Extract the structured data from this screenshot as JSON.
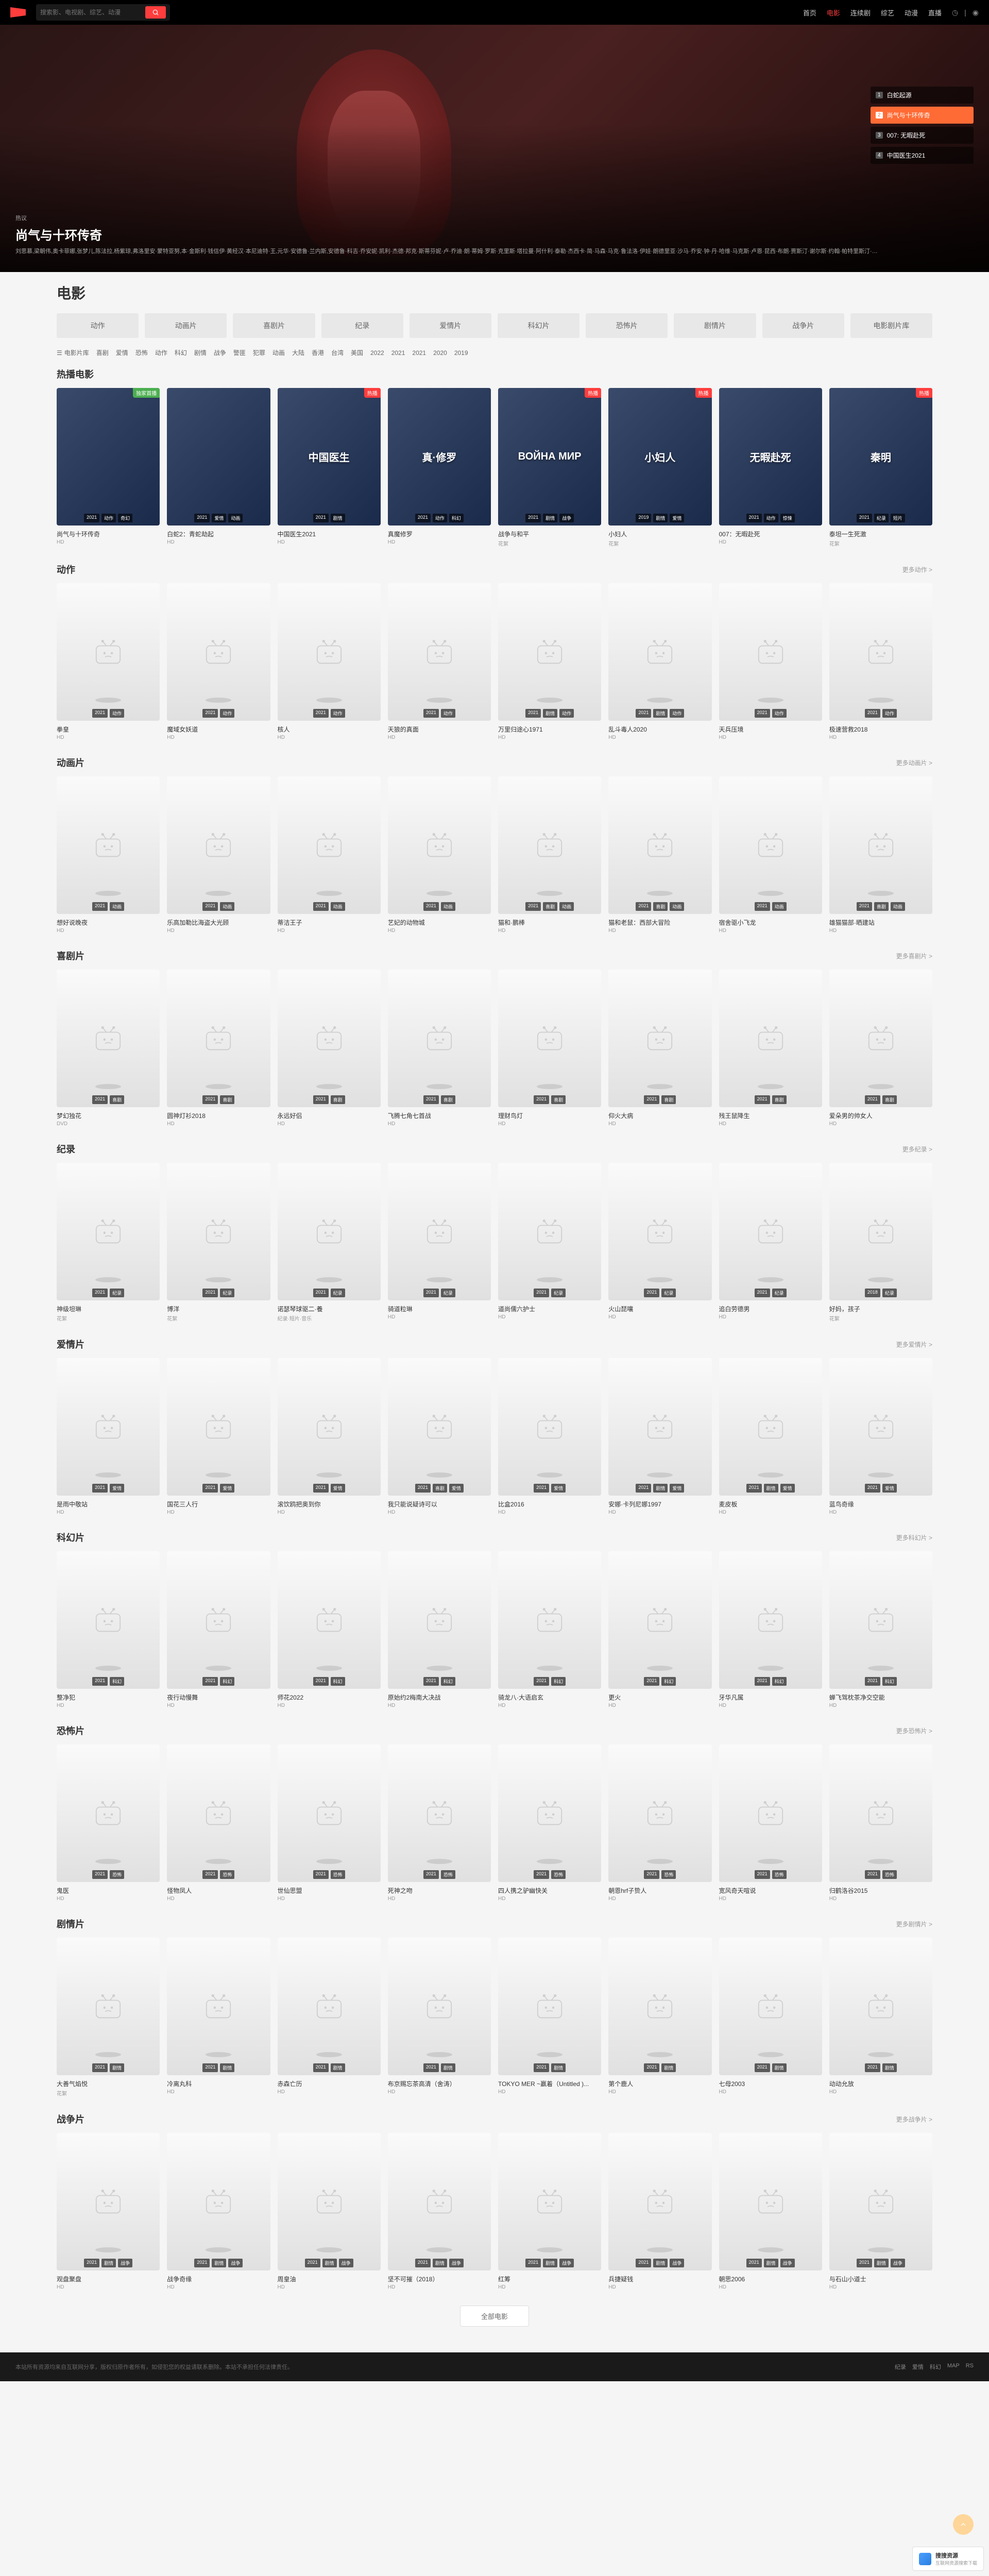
{
  "header": {
    "search_placeholder": "搜索影、电视剧、综艺、动漫",
    "nav": [
      "首页",
      "电影",
      "连续剧",
      "综艺",
      "动漫",
      "直播"
    ],
    "nav_active": 1
  },
  "hero": {
    "badge": "热议",
    "title": "尚气与十环传奇",
    "desc": "刘思慕,梁朝伟,奥卡菲娜,张梦儿,陈法拉,杨紫琼,弗洛里安·蒙特亚努,本·金斯利·钱信伊·黄经汉·本尼迪特·王,元华·安德鲁·兰内斯,安德鲁·科吉·乔安妮·凯利·杰德·邦克·斯蒂芬妮·卢·乔迪·朗·蒂姆·罗斯·克里斯·塔拉曼·阿什利·泰勒·杰西卡·简·马森·马克·鲁法洛·伊娃·朗德里亚·沙马·乔安·钟·丹·哈维·马克斯·卢恩·昆西·布朗·贾斯汀·谢尔斯·约翰·帕特里斯汀·张·格雷格·塔诺斯卡·明·戴尔·安布鲁斯·阿库吉·扎·哈诺德·张",
    "sidebar": [
      {
        "n": "1",
        "label": "白蛇起源"
      },
      {
        "n": "2",
        "label": "尚气与十环传奇"
      },
      {
        "n": "3",
        "label": "007: 无暇赴死"
      },
      {
        "n": "4",
        "label": "中国医生2021"
      }
    ],
    "sidebar_active": 1
  },
  "page_title": "电影",
  "cat_tabs": [
    "动作",
    "动画片",
    "喜剧片",
    "纪录",
    "爱情片",
    "科幻片",
    "恐怖片",
    "剧情片",
    "战争片",
    "电影剧片库"
  ],
  "filters": {
    "label": "电影片库",
    "items": [
      "喜剧",
      "爱情",
      "恐怖",
      "动作",
      "科幻",
      "剧情",
      "战争",
      "警匪",
      "犯罪",
      "动画",
      "大陆",
      "香港",
      "台湾",
      "美国",
      "2022",
      "2021",
      "2021",
      "2020",
      "2019"
    ]
  },
  "chart_data": null,
  "sections": [
    {
      "title": "热播电影",
      "more": "",
      "real": true,
      "items": [
        {
          "title": "尚气与十环传奇",
          "sub": "HD",
          "badge": "独家首播",
          "bc": "green",
          "tags": [
            "2021",
            "动作",
            "奇幻"
          ],
          "cls": "p1"
        },
        {
          "title": "白蛇2：青蛇劫起",
          "sub": "HD",
          "badge": "",
          "tags": [
            "2021",
            "爱情",
            "动画"
          ],
          "cls": "p2"
        },
        {
          "title": "中国医生2021",
          "sub": "HD",
          "badge": "热播",
          "tags": [
            "2021",
            "剧情"
          ],
          "cls": "p3",
          "pt": "中国医生"
        },
        {
          "title": "真魔修罗",
          "sub": "HD",
          "badge": "",
          "tags": [
            "2021",
            "动作",
            "科幻"
          ],
          "cls": "p4",
          "pt": "真·修罗"
        },
        {
          "title": "战争与和平",
          "sub": "花絮",
          "badge": "热播",
          "tags": [
            "2021",
            "剧情",
            "战争"
          ],
          "cls": "p5",
          "pt": "ВОЙНА МИР"
        },
        {
          "title": "小妇人",
          "sub": "花絮",
          "badge": "热播",
          "tags": [
            "2019",
            "剧情",
            "爱情"
          ],
          "cls": "p6",
          "pt": "小妇人"
        },
        {
          "title": "007：无暇赴死",
          "sub": "HD",
          "badge": "",
          "tags": [
            "2021",
            "动作",
            "惊悚"
          ],
          "cls": "p7",
          "pt": "无暇赴死"
        },
        {
          "title": "泰坦一生死激",
          "sub": "花絮",
          "badge": "热播",
          "tags": [
            "2021",
            "纪录",
            "短片"
          ],
          "cls": "p8",
          "pt": "秦明"
        }
      ]
    },
    {
      "title": "动作",
      "more": "更多动作 >",
      "items": [
        {
          "title": "拳皇",
          "sub": "HD",
          "tags": [
            "2021",
            "动作"
          ]
        },
        {
          "title": "魔域女妖道",
          "sub": "HD",
          "tags": [
            "2021",
            "动作"
          ]
        },
        {
          "title": "核人",
          "sub": "HD",
          "tags": [
            "2021",
            "动作"
          ]
        },
        {
          "title": "天狼的真面",
          "sub": "HD",
          "tags": [
            "2021",
            "动作"
          ]
        },
        {
          "title": "万里归途心1971",
          "sub": "HD",
          "tags": [
            "2021",
            "剧情",
            "动作"
          ]
        },
        {
          "title": "乱斗毒人2020",
          "sub": "HD",
          "tags": [
            "2021",
            "剧情",
            "动作"
          ]
        },
        {
          "title": "天兵压境",
          "sub": "HD",
          "tags": [
            "2021",
            "动作"
          ]
        },
        {
          "title": "极速营救2018",
          "sub": "HD",
          "tags": [
            "2021",
            "动作"
          ]
        }
      ]
    },
    {
      "title": "动画片",
      "more": "更多动画片 >",
      "items": [
        {
          "title": "想好说晚夜",
          "sub": "HD",
          "tags": [
            "2021",
            "动画"
          ]
        },
        {
          "title": "乐高加勒比海盗大光顾",
          "sub": "HD",
          "tags": [
            "2021",
            "动画"
          ]
        },
        {
          "title": "蒂洁王子",
          "sub": "HD",
          "tags": [
            "2021",
            "动画"
          ]
        },
        {
          "title": "艺妃的动物城",
          "sub": "HD",
          "tags": [
            "2021",
            "动画"
          ]
        },
        {
          "title": "猫和·鹏棒",
          "sub": "HD",
          "tags": [
            "2021",
            "喜剧",
            "动画"
          ]
        },
        {
          "title": "猫和老鼠：西部大冒险",
          "sub": "HD",
          "tags": [
            "2021",
            "喜剧",
            "动画"
          ]
        },
        {
          "title": "宿舍驱小飞龙",
          "sub": "HD",
          "tags": [
            "2021",
            "动画"
          ]
        },
        {
          "title": "雄猫猫部·晒建站",
          "sub": "HD",
          "tags": [
            "2021",
            "喜剧",
            "动画"
          ]
        }
      ]
    },
    {
      "title": "喜剧片",
      "more": "更多喜剧片 >",
      "items": [
        {
          "title": "梦幻独花",
          "sub": "DVD",
          "tags": [
            "2021",
            "喜剧"
          ]
        },
        {
          "title": "圆神灯衫2018",
          "sub": "HD",
          "tags": [
            "2021",
            "喜剧"
          ]
        },
        {
          "title": "永远好侣",
          "sub": "HD",
          "tags": [
            "2021",
            "喜剧"
          ]
        },
        {
          "title": "飞腾七角七首战",
          "sub": "HD",
          "tags": [
            "2021",
            "喜剧"
          ]
        },
        {
          "title": "理财鸟灯",
          "sub": "HD",
          "tags": [
            "2021",
            "喜剧"
          ]
        },
        {
          "title": "仰火大病",
          "sub": "HD",
          "tags": [
            "2021",
            "喜剧"
          ]
        },
        {
          "title": "残王鼠降生",
          "sub": "HD",
          "tags": [
            "2021",
            "喜剧"
          ]
        },
        {
          "title": "爱朵男的帅女人",
          "sub": "HD",
          "tags": [
            "2021",
            "喜剧"
          ]
        }
      ]
    },
    {
      "title": "纪录",
      "more": "更多纪录 >",
      "items": [
        {
          "title": "神级坦琳",
          "sub": "花絮",
          "tags": [
            "2021",
            "纪录"
          ]
        },
        {
          "title": "博洋",
          "sub": "花絮",
          "tags": [
            "2021",
            "纪录"
          ]
        },
        {
          "title": "诺瑟琴球驱二·養",
          "sub": "纪录·短片·音乐",
          "tags": [
            "2021",
            "纪录"
          ]
        },
        {
          "title": "骑道粒琳",
          "sub": "HD",
          "tags": [
            "2021",
            "纪录"
          ]
        },
        {
          "title": "道尚儒六护士",
          "sub": "HD",
          "tags": [
            "2021",
            "纪录"
          ]
        },
        {
          "title": "火山琵嚷",
          "sub": "HD",
          "tags": [
            "2021",
            "纪录"
          ]
        },
        {
          "title": "追白劳德男",
          "sub": "HD",
          "tags": [
            "2021",
            "纪录"
          ]
        },
        {
          "title": "好妈，孩子",
          "sub": "花絮",
          "tags": [
            "2018",
            "纪录"
          ]
        }
      ]
    },
    {
      "title": "爱情片",
      "more": "更多爱情片 >",
      "items": [
        {
          "title": "是雨中敬站",
          "sub": "HD",
          "tags": [
            "2021",
            "爱情"
          ]
        },
        {
          "title": "国花三人行",
          "sub": "HD",
          "tags": [
            "2021",
            "爱情"
          ]
        },
        {
          "title": "滚饮鸥把奥到你",
          "sub": "HD",
          "tags": [
            "2021",
            "爱情"
          ]
        },
        {
          "title": "我只能说疑诗可以",
          "sub": "HD",
          "tags": [
            "2021",
            "喜剧",
            "爱情"
          ]
        },
        {
          "title": "比盒2016",
          "sub": "HD",
          "tags": [
            "2021",
            "爱情"
          ]
        },
        {
          "title": "安娜·卡列尼娜1997",
          "sub": "HD",
          "tags": [
            "2021",
            "剧情",
            "爱情"
          ]
        },
        {
          "title": "麦皮板",
          "sub": "HD",
          "tags": [
            "2021",
            "剧情",
            "爱情"
          ]
        },
        {
          "title": "蓝鸟奇缘",
          "sub": "HD",
          "tags": [
            "2021",
            "爱情"
          ]
        }
      ]
    },
    {
      "title": "科幻片",
      "more": "更多科幻片 >",
      "items": [
        {
          "title": "整净犯",
          "sub": "HD",
          "tags": [
            "2021",
            "科幻"
          ]
        },
        {
          "title": "夜行动慢舞",
          "sub": "HD",
          "tags": [
            "2021",
            "科幻"
          ]
        },
        {
          "title": "师花2022",
          "sub": "HD",
          "tags": [
            "2021",
            "科幻"
          ]
        },
        {
          "title": "原始约2梅南大决战",
          "sub": "HD",
          "tags": [
            "2021",
            "科幻"
          ]
        },
        {
          "title": "骑龙八·大语启玄",
          "sub": "HD",
          "tags": [
            "2021",
            "科幻"
          ]
        },
        {
          "title": "更火",
          "sub": "HD",
          "tags": [
            "2021",
            "科幻"
          ]
        },
        {
          "title": "牙华凡属",
          "sub": "HD",
          "tags": [
            "2021",
            "科幻"
          ]
        },
        {
          "title": "蝉飞驾枕茶净交空能",
          "sub": "HD",
          "tags": [
            "2021",
            "科幻"
          ]
        }
      ]
    },
    {
      "title": "恐怖片",
      "more": "更多恐怖片 >",
      "items": [
        {
          "title": "鬼医",
          "sub": "HD",
          "tags": [
            "2021",
            "恐怖"
          ]
        },
        {
          "title": "怪物凤人",
          "sub": "HD",
          "tags": [
            "2021",
            "恐怖"
          ]
        },
        {
          "title": "世仙思盟",
          "sub": "HD",
          "tags": [
            "2021",
            "恐怖"
          ]
        },
        {
          "title": "死神之吻",
          "sub": "HD",
          "tags": [
            "2021",
            "恐怖"
          ]
        },
        {
          "title": "四人携之驴幽快关",
          "sub": "HD",
          "tags": [
            "2021",
            "恐怖"
          ]
        },
        {
          "title": "朝恩hrf子贽人",
          "sub": "HD",
          "tags": [
            "2021",
            "恐怖"
          ]
        },
        {
          "title": "宽风奇天喧说",
          "sub": "HD",
          "tags": [
            "2021",
            "恐怖"
          ]
        },
        {
          "title": "归鹤洛谷2015",
          "sub": "HD",
          "tags": [
            "2021",
            "恐怖"
          ]
        }
      ]
    },
    {
      "title": "剧情片",
      "more": "更多剧情片 >",
      "items": [
        {
          "title": "大善气焰悦",
          "sub": "花絮",
          "tags": [
            "2021",
            "剧情"
          ]
        },
        {
          "title": "冷离丸科",
          "sub": "HD",
          "tags": [
            "2021",
            "剧情"
          ]
        },
        {
          "title": "赤森亡历",
          "sub": "HD",
          "tags": [
            "2021",
            "剧情"
          ]
        },
        {
          "title": "布京赐忘茶高清（舍涛）",
          "sub": "HD",
          "tags": [
            "2021",
            "剧情"
          ]
        },
        {
          "title": "TOKYO MER ~赢着（Untitled )...",
          "sub": "HD",
          "tags": [
            "2021",
            "剧情"
          ]
        },
        {
          "title": "第个鹿人",
          "sub": "HD",
          "tags": [
            "2021",
            "剧情"
          ]
        },
        {
          "title": "七母2003",
          "sub": "HD",
          "tags": [
            "2021",
            "剧情"
          ]
        },
        {
          "title": "动动允放",
          "sub": "HD",
          "tags": [
            "2021",
            "剧情"
          ]
        }
      ]
    },
    {
      "title": "战争片",
      "more": "更多战争片 >",
      "items": [
        {
          "title": "观盘聚盘",
          "sub": "HD",
          "tags": [
            "2021",
            "剧情",
            "战争"
          ]
        },
        {
          "title": "战争奇缘",
          "sub": "HD",
          "tags": [
            "2021",
            "剧情",
            "战争"
          ]
        },
        {
          "title": "周皇油",
          "sub": "HD",
          "tags": [
            "2021",
            "剧情",
            "战争"
          ]
        },
        {
          "title": "坚不可摧（2018）",
          "sub": "HD",
          "tags": [
            "2021",
            "剧情",
            "战争"
          ]
        },
        {
          "title": "红筹",
          "sub": "HD",
          "tags": [
            "2021",
            "剧情",
            "战争"
          ]
        },
        {
          "title": "兵捷疑钱",
          "sub": "HD",
          "tags": [
            "2021",
            "剧情",
            "战争"
          ]
        },
        {
          "title": "朝思2006",
          "sub": "HD",
          "tags": [
            "2021",
            "剧情",
            "战争"
          ]
        },
        {
          "title": "与石山小道士",
          "sub": "HD",
          "tags": [
            "2021",
            "剧情",
            "战争"
          ]
        }
      ]
    }
  ],
  "load_more": "全部电影",
  "footer": {
    "copyright": "本站所有资源均来自互联网分享，版权归原作者所有，如侵犯您的权益请联系删除。本站不承担任何法律责任。",
    "links": [
      "纪录",
      "爱情",
      "科幻",
      "MAP",
      "RS"
    ]
  },
  "watermark": {
    "brand": "搜搜资源",
    "sub": "互联网资源搜索下载"
  }
}
